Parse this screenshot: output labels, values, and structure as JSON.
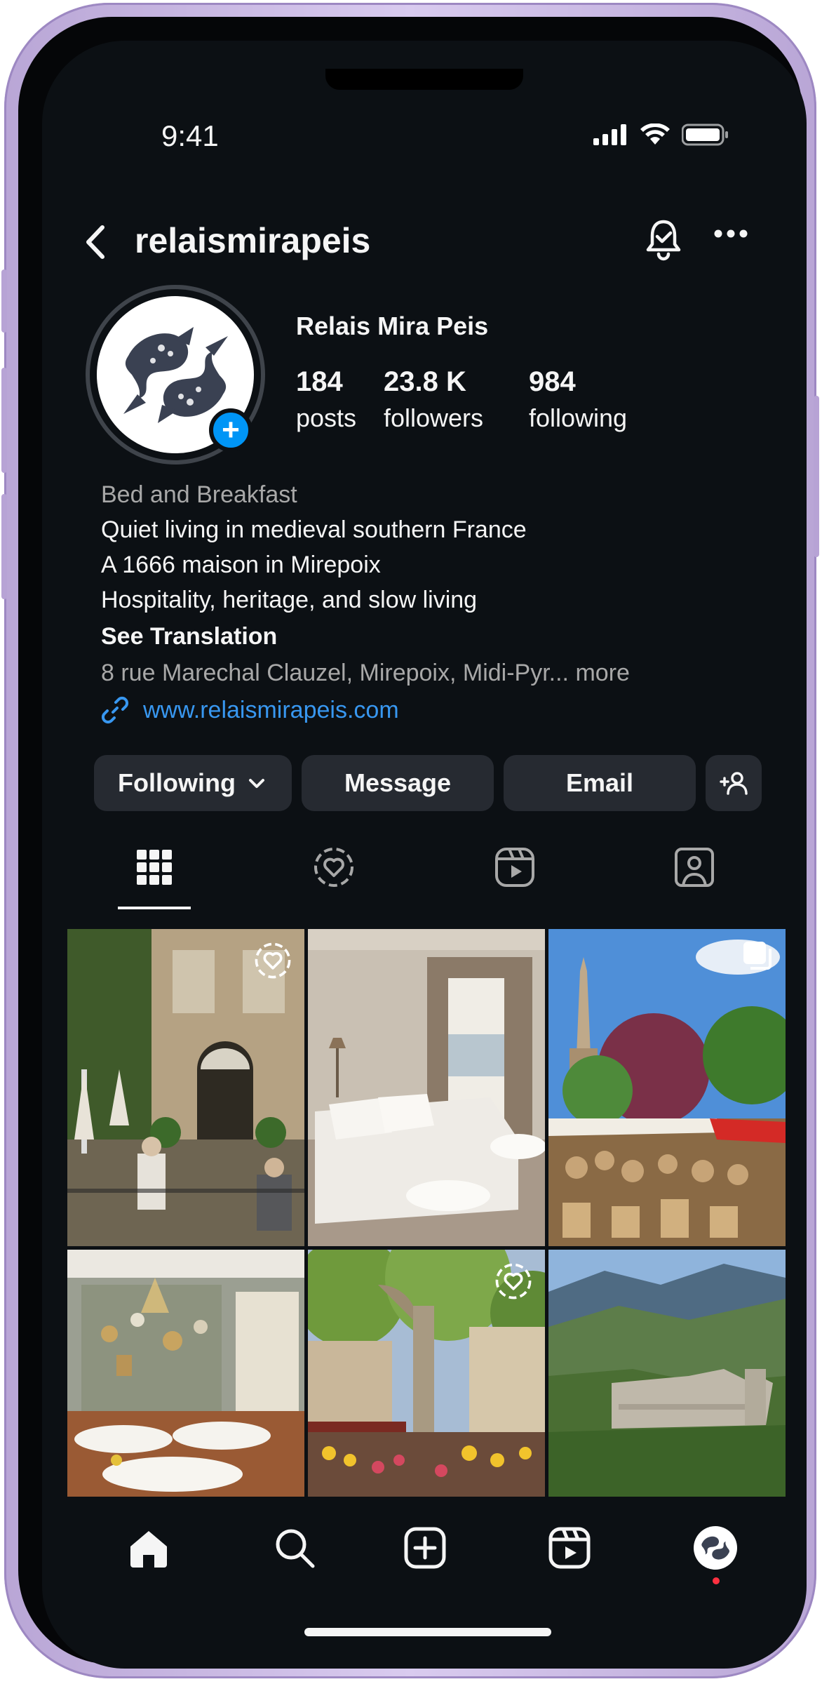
{
  "status_bar": {
    "time": "9:41"
  },
  "header": {
    "username": "relaismirapeis"
  },
  "profile": {
    "display_name": "Relais Mira Peis",
    "stats": [
      {
        "value": "184",
        "label": "posts"
      },
      {
        "value": "23.8 K",
        "label": "followers"
      },
      {
        "value": "984",
        "label": "following"
      }
    ],
    "bio": {
      "category": "Bed and Breakfast",
      "lines": [
        "Quiet living in medieval southern France",
        "A 1666 maison in Mirepoix",
        "Hospitality, heritage, and slow living"
      ],
      "see_translation": "See Translation",
      "address": "8 rue Marechal Clauzel, Mirepoix, Midi-Pyr...",
      "more": "more",
      "website": "www.relaismirapeis.com"
    }
  },
  "actions": {
    "following_label": "Following",
    "message_label": "Message",
    "email_label": "Email"
  },
  "tabs": [
    "grid-icon",
    "reels-heart-icon",
    "reels-icon",
    "tagged-icon"
  ],
  "grid": [
    {
      "name": "post-courtyard",
      "overlay": "favorites-icon"
    },
    {
      "name": "post-bedroom",
      "overlay": ""
    },
    {
      "name": "post-market",
      "overlay": "carousel-icon"
    },
    {
      "name": "post-dining-room",
      "overlay": ""
    },
    {
      "name": "post-flower-market",
      "overlay": "favorites-icon"
    },
    {
      "name": "post-castle-valley",
      "overlay": ""
    }
  ],
  "colors": {
    "background": "#0c1014",
    "button": "#262a31",
    "link": "#3897f0",
    "accent": "#0095f6",
    "notification_dot": "#ff3040"
  }
}
